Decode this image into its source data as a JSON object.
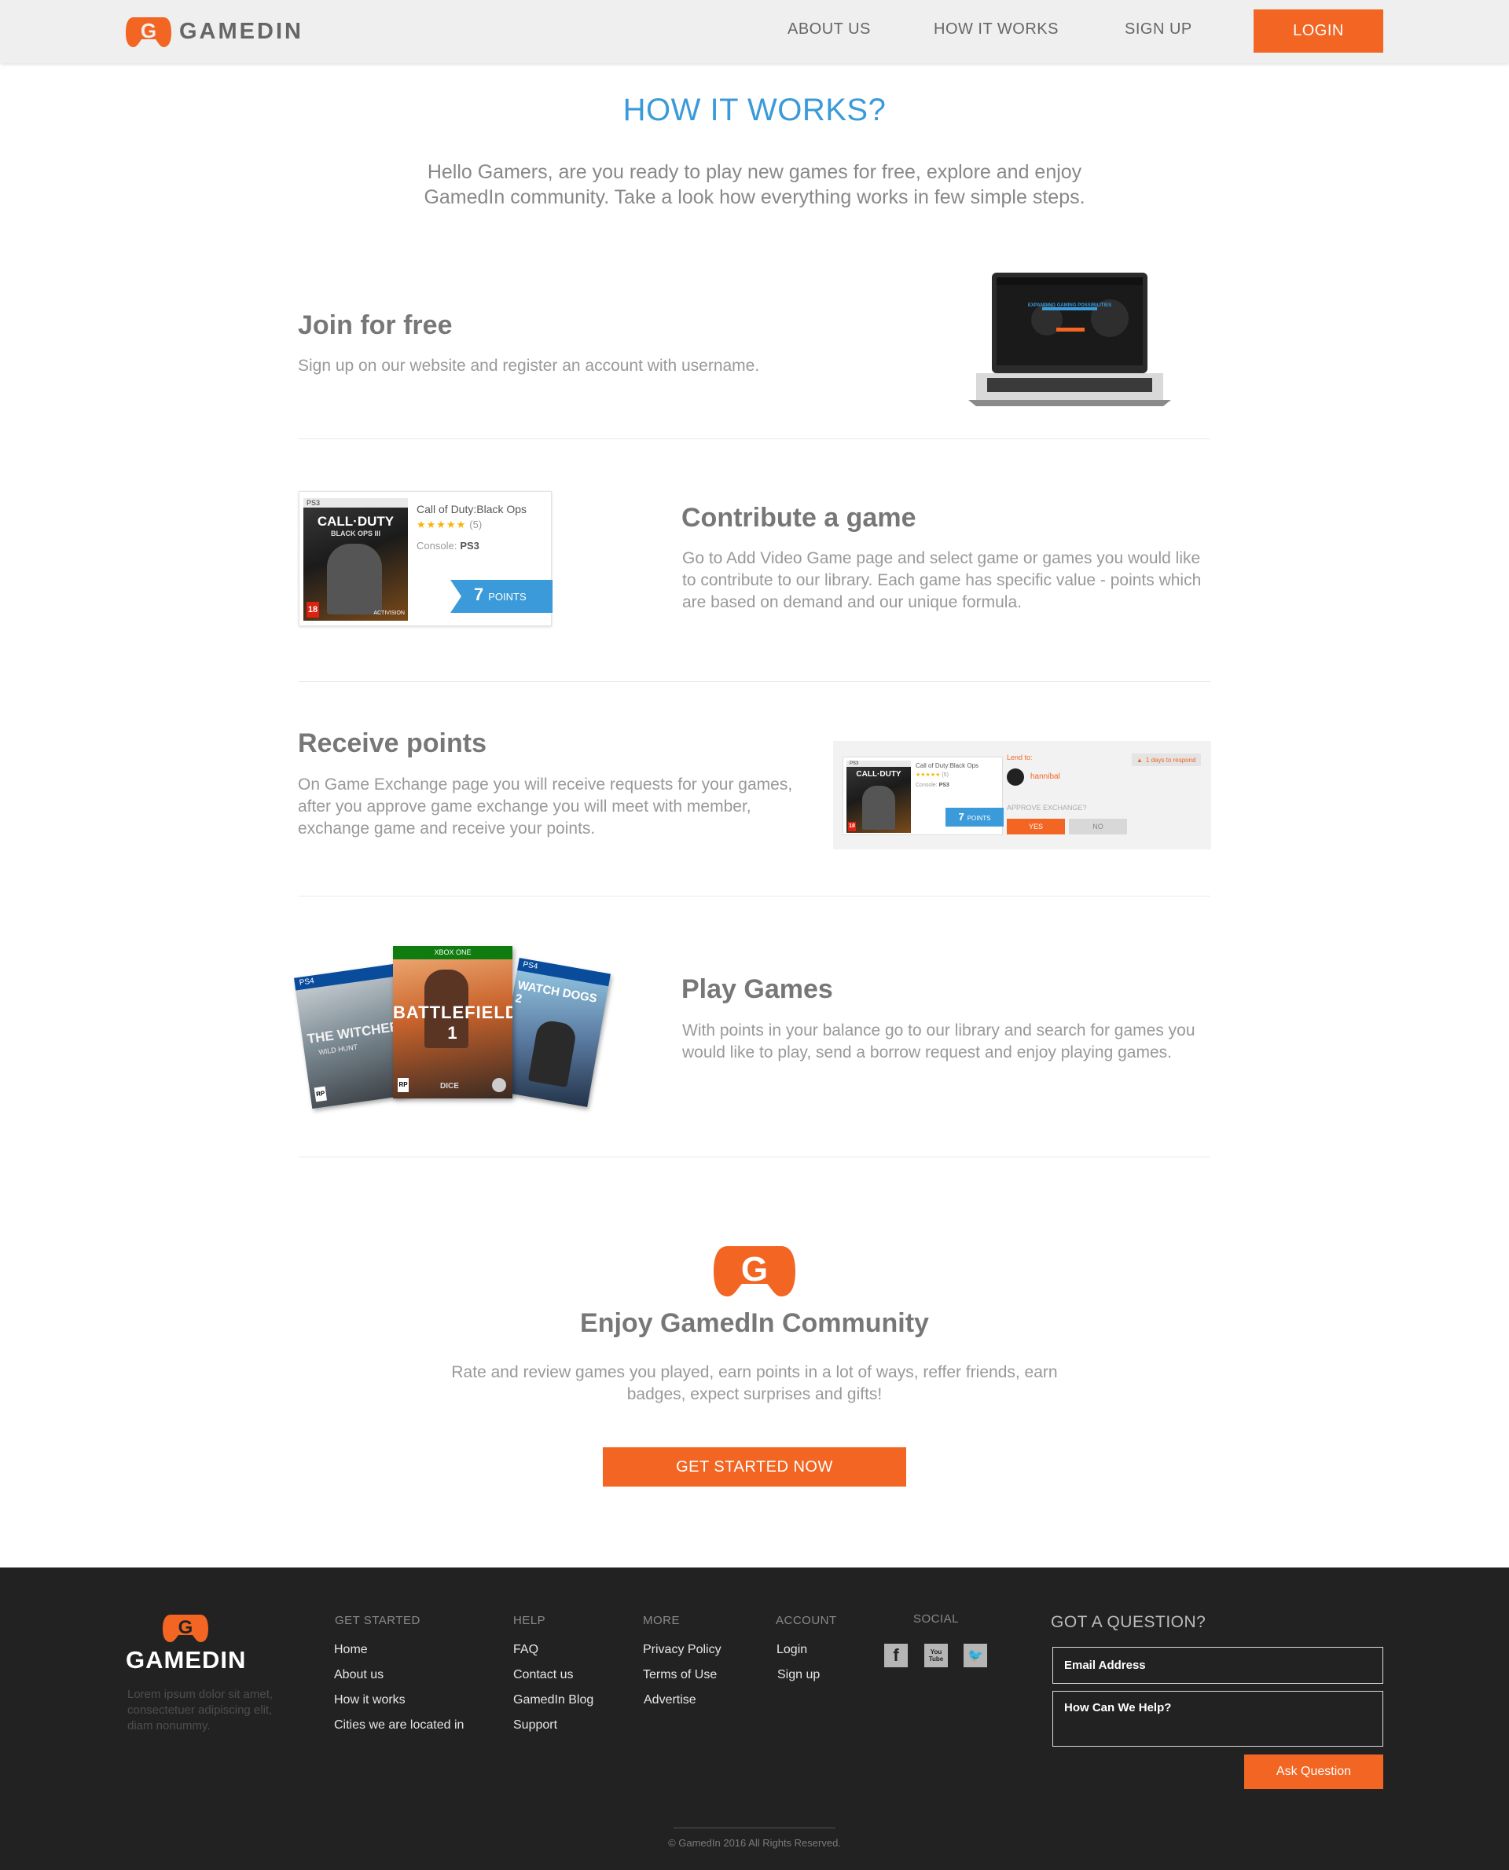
{
  "header": {
    "brand": "GAMEDIN",
    "nav": [
      "ABOUT US",
      "HOW IT WORKS",
      "SIGN UP"
    ],
    "login_label": "LOGIN"
  },
  "hero": {
    "title": "HOW IT WORKS?",
    "intro": "Hello Gamers, are you ready to play new games for free, explore and enjoy GamedIn community. Take a look how everything works in few simple steps."
  },
  "steps": [
    {
      "title": "Join for free",
      "desc": "Sign up on our website and register an account with username."
    },
    {
      "title": "Contribute a game",
      "desc": "Go to Add Video Game page and select game or games you would like to contribute to our library. Each game has specific value - points which are based on demand and our unique formula."
    },
    {
      "title": "Receive points",
      "desc": "On Game Exchange page you will receive requests for your games, after you approve game exchange you will meet with member, exchange game and receive your points."
    },
    {
      "title": "Play Games",
      "desc": "With points in your balance go to our library and search for games you would like to play, send a borrow request and enjoy playing games."
    }
  ],
  "laptop_screen": {
    "headline": "EXPANDING GAMING POSSIBILITIES"
  },
  "game_card": {
    "title": "Call of Duty:Black Ops",
    "stars": "★★★★★",
    "rating_count": "(5)",
    "console_label": "Console:",
    "console_value": "PS3",
    "points_number": "7",
    "points_label": "POINTS",
    "cover_platform": "PS3",
    "cover_title": "CALL·DUTY",
    "cover_subtitle": "BLACK OPS III",
    "cover_rating": "18",
    "cover_publisher": "ACTIVISION"
  },
  "exchange_card": {
    "lend_to_label": "Lend to:",
    "username": "hannibal",
    "respond_badge": "1 days to respond",
    "approve_label": "APPROVE EXCHANGE?",
    "yes_label": "YES",
    "no_label": "NO"
  },
  "games": [
    {
      "platform": "PS4",
      "title": "THE WITCHER",
      "subtitle": "WILD HUNT",
      "rating": "RP"
    },
    {
      "platform": "XBOX ONE",
      "title": "BATTLEFIELD 1",
      "rating": "RP",
      "publisher": "DICE"
    },
    {
      "platform": "PS4",
      "title": "WATCH DOGS 2"
    }
  ],
  "cta": {
    "title": "Enjoy GamedIn Community",
    "desc": "Rate and review games you played, earn points in a lot of ways, reffer friends, earn badges, expect surprises and gifts!",
    "button": "GET STARTED NOW"
  },
  "footer": {
    "brand": "GAMEDIN",
    "lorem": "Lorem ipsum dolor sit amet, consectetuer adipiscing elit, diam nonummy.",
    "columns": [
      {
        "heading": "GET STARTED",
        "links": [
          "Home",
          "About us",
          "How it works",
          "Cities we are located in"
        ]
      },
      {
        "heading": "HELP",
        "links": [
          "FAQ",
          "Contact us",
          "GamedIn Blog",
          "Support"
        ]
      },
      {
        "heading": "MORE",
        "links": [
          "Privacy Policy",
          "Terms of Use",
          "Advertise"
        ]
      },
      {
        "heading": "ACCOUNT",
        "links": [
          "Login",
          "Sign up"
        ]
      }
    ],
    "social_heading": "SOCIAL",
    "social": [
      {
        "icon": "facebook-icon",
        "glyph": "f"
      },
      {
        "icon": "youtube-icon",
        "glyph": "You Tube"
      },
      {
        "icon": "twitter-icon",
        "glyph": "🐦"
      }
    ],
    "question_title": "GOT A QUESTION?",
    "email_placeholder": "Email Address",
    "help_placeholder": "How Can We Help?",
    "ask_button": "Ask Question",
    "copyright": "© GamedIn 2016 All Rights Reserved."
  },
  "colors": {
    "accent": "#f26522",
    "title_blue": "#3b9ad9",
    "footer_bg": "#222222"
  }
}
